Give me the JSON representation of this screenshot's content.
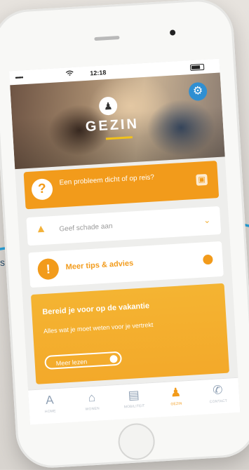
{
  "status_bar": {
    "time": "12:18",
    "signal": "•••••",
    "wifi": "wifi-icon"
  },
  "hero": {
    "title": "GEZIN",
    "settings_icon": "gear-icon",
    "logo_icon": "family-icon"
  },
  "cards": {
    "question": {
      "text": "Een probleem dicht of op reis?",
      "icon": "question-icon",
      "side_icon": "clipboard-icon"
    },
    "damage": {
      "text": "Geef schade aan",
      "icon": "car-crash-icon"
    },
    "tips": {
      "text": "Meer tips & advies",
      "icon": "lightbulb-icon"
    },
    "promo": {
      "title": "Bereid je voor op de vakantie",
      "subtitle": "Alles wat je moet weten voor je vertrekt",
      "button": "Meer lezen"
    }
  },
  "tabs": [
    {
      "label": "HOME",
      "icon": "home-logo-icon"
    },
    {
      "label": "WONEN",
      "icon": "house-icon"
    },
    {
      "label": "MOBILITEIT",
      "icon": "car-icon"
    },
    {
      "label": "GEZIN",
      "icon": "family-icon"
    },
    {
      "label": "CONTACT",
      "icon": "phone-icon"
    }
  ],
  "annotation": {
    "left_label": "s"
  },
  "colors": {
    "accent": "#f29b1b",
    "settings_blue": "#2f8fd2",
    "arrow_blue": "#2aa3dc"
  }
}
